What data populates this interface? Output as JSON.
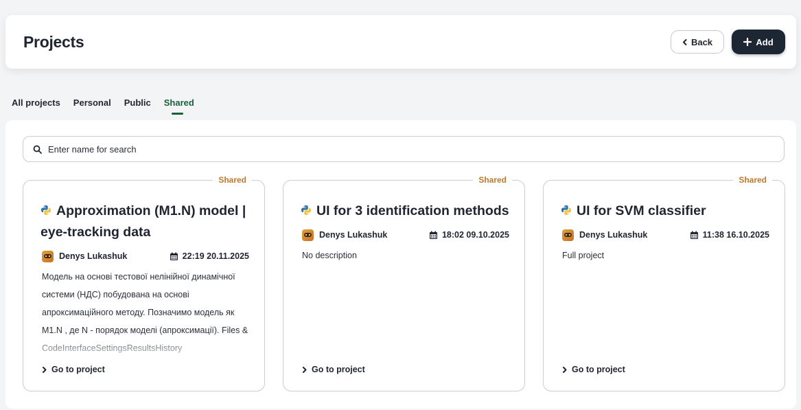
{
  "header": {
    "title": "Projects",
    "back_label": "Back",
    "add_label": "Add"
  },
  "tabs": [
    {
      "label": "All projects",
      "active": false
    },
    {
      "label": "Personal",
      "active": false
    },
    {
      "label": "Public",
      "active": false
    },
    {
      "label": "Shared",
      "active": true
    }
  ],
  "search": {
    "placeholder": "Enter name for search",
    "value": ""
  },
  "cards": [
    {
      "badge": "Shared",
      "title": "Approximation (M1.N) model | eye-tracking data",
      "author": "Denys Lukashuk",
      "datetime": "22:19 20.11.2025",
      "description": "Модель на основі тестової нелінійної динамічної системи (НДС) побудована на основі апроксимаційного методу. Позначимо модель як M1.N , де N - порядок моделі (апроксимації). Files & CodeInterfaceSettingsResultsHistory",
      "link": "Go to project"
    },
    {
      "badge": "Shared",
      "title": "UI for 3 identification methods",
      "author": "Denys Lukashuk",
      "datetime": "18:02 09.10.2025",
      "description": "No description",
      "link": "Go to project"
    },
    {
      "badge": "Shared",
      "title": "UI for SVM classifier",
      "author": "Denys Lukashuk",
      "datetime": "11:38 16.10.2025",
      "description": "Full project",
      "link": "Go to project"
    }
  ],
  "colors": {
    "accent_green": "#1b5e3b",
    "badge_orange": "#c0782a",
    "primary_button": "#1d2633",
    "python_blue": "#3572a5",
    "python_yellow": "#f2c43d"
  },
  "icons": {
    "back": "chevron-left-icon",
    "add": "plus-icon",
    "search": "search-icon",
    "project": "python-icon",
    "date": "calendar-icon",
    "link": "chevron-right-icon",
    "author": "avatar"
  }
}
